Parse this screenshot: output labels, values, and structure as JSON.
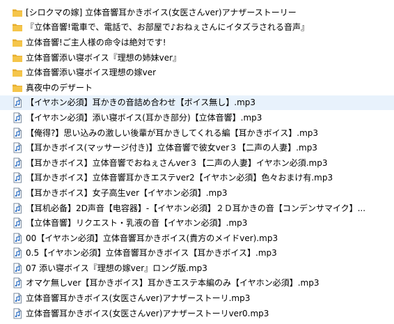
{
  "window": {
    "view": "file-list"
  },
  "colors": {
    "folder_fill": "#f5c54a",
    "folder_tab": "#e6ad2e",
    "file_border": "#7a8a9c",
    "note_color": "#2d6fc4",
    "selection": "#e8f2fc"
  },
  "items": [
    {
      "type": "folder",
      "icon": "folder-icon",
      "name": "[シロクマの嫁] 立体音響耳かきボイス(女医さんver)アナザーストーリー"
    },
    {
      "type": "folder",
      "icon": "folder-icon",
      "name": "『立体音響!電車で、電話で、お部屋で♪おねぇさんにイタズラされる音声』"
    },
    {
      "type": "folder",
      "icon": "folder-icon",
      "name": "立体音響!ご主人様の命令は絶対です!"
    },
    {
      "type": "folder",
      "icon": "folder-icon",
      "name": "立体音響添い寝ボイス『理想の姉妹ver』"
    },
    {
      "type": "folder",
      "icon": "folder-icon",
      "name": "立体音響添い寝ボイス理想の嫁ver"
    },
    {
      "type": "folder",
      "icon": "folder-icon",
      "name": "真夜中のデザート"
    },
    {
      "type": "audio",
      "icon": "audio-file-icon",
      "name": "【イヤホン必須】耳かきの音詰め合わせ【ボイス無し】.mp3"
    },
    {
      "type": "audio",
      "icon": "audio-file-icon",
      "name": "【イヤホン必須】添い寝ボイス(耳かき部分)【立体音響】.mp3"
    },
    {
      "type": "audio",
      "icon": "audio-file-icon",
      "name": "【俺得?】思い込みの激しい後輩が耳かきしてくれる編【耳かきボイス】.mp3"
    },
    {
      "type": "audio",
      "icon": "audio-file-icon",
      "name": "【耳かきボイス(マッサージ付き)】立体音響で彼女ver３【二声の人妻】.mp3"
    },
    {
      "type": "audio",
      "icon": "audio-file-icon",
      "name": "【耳かきボイス】立体音響でおねぇさんver３【二声の人妻】イヤホン必須.mp3"
    },
    {
      "type": "audio",
      "icon": "audio-file-icon",
      "name": "【耳かきボイス】立体音響耳かきエステver2【イヤホン必須】色々おまけ有.mp3"
    },
    {
      "type": "audio",
      "icon": "audio-file-icon",
      "name": "【耳かきボイス】女子高生ver【イヤホン必須】.mp3"
    },
    {
      "type": "audio",
      "icon": "audio-file-icon",
      "name": "【耳机必备】2D声音【电容器】-【イヤホン必須】２Ｄ耳かきの音【コンデンサマイク】..."
    },
    {
      "type": "audio",
      "icon": "audio-file-icon",
      "name": "【立体音響】リクエスト・乳液の音【イヤホン必須】.mp3"
    },
    {
      "type": "audio",
      "icon": "audio-file-icon",
      "name": "00【イヤホン必須】立体音響耳かきボイス(貴方のメイドver).mp3"
    },
    {
      "type": "audio",
      "icon": "audio-file-icon",
      "name": "0.5【イヤホン必須】立体音響耳かきボイス【耳かきボイス】.mp3"
    },
    {
      "type": "audio",
      "icon": "audio-file-icon",
      "name": "07 添い寝ボイス『理想の嫁ver』ロング版.mp3"
    },
    {
      "type": "audio",
      "icon": "audio-file-icon",
      "name": "オマケ無しver【耳かきボイス】耳かきエステ本編のみ【イヤホン必須】.mp3"
    },
    {
      "type": "audio",
      "icon": "audio-file-icon",
      "name": "立体音響耳かきボイス(女医さんver)アナザーストーリ.mp3"
    },
    {
      "type": "audio",
      "icon": "audio-file-icon",
      "name": "立体音響耳かきボイス(女医さんver)アナザーストーリver0.mp3"
    }
  ]
}
